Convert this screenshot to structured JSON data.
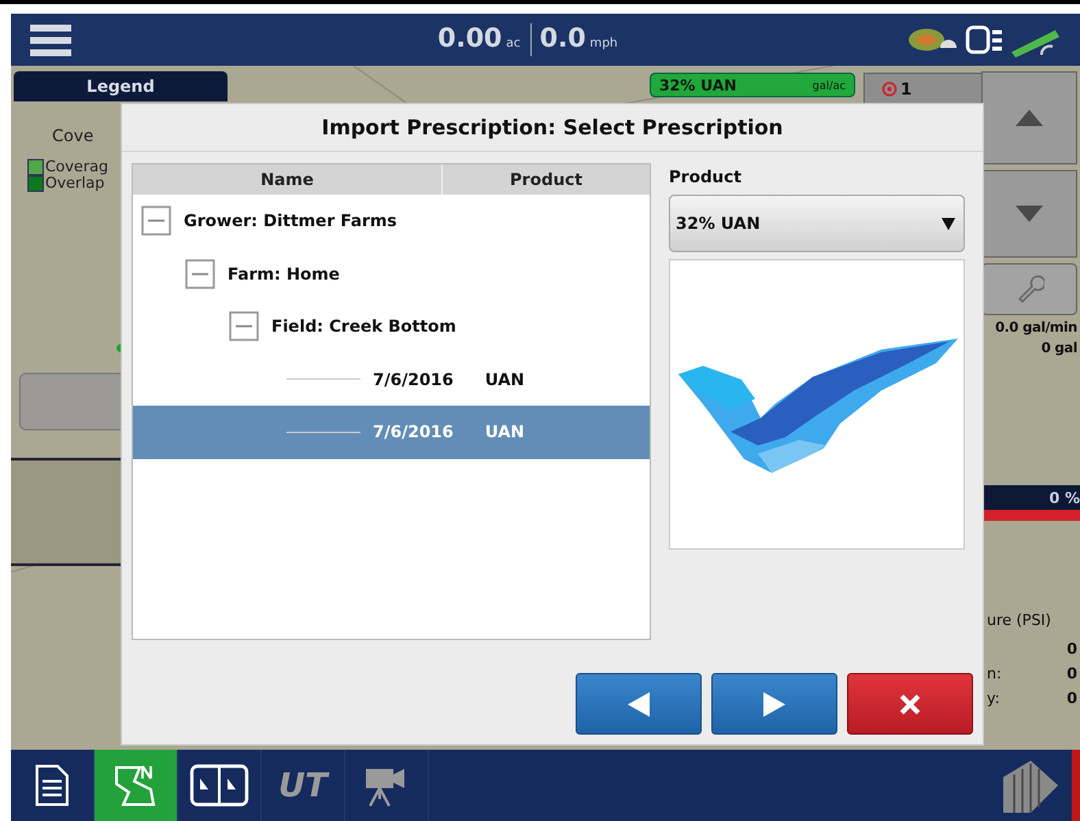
{
  "top_bar": {
    "area": "0.00",
    "area_unit": "ac",
    "speed": "0.0",
    "speed_unit": "mph"
  },
  "legend": {
    "title": "Legend",
    "heading": "Cove",
    "items": [
      {
        "label": "Coverag",
        "color": "#4fa84a"
      },
      {
        "label": "Overlap",
        "color": "#0b7a1e"
      }
    ]
  },
  "product_badge": {
    "name": "32% UAN",
    "unit": "gal/ac"
  },
  "alarm": {
    "count": "1"
  },
  "right_panel": {
    "flow": "0.0 gal/min",
    "total": "0 gal",
    "percent": "0 %",
    "pressure_title": "ure (PSI)",
    "readings": [
      {
        "value": "0"
      },
      {
        "label": "n:",
        "value": "0"
      },
      {
        "label": "y:",
        "value": "0"
      }
    ]
  },
  "dialog": {
    "title": "Import Prescription: Select Prescription",
    "columns": [
      "Name",
      "Product"
    ],
    "tree": [
      {
        "label": "Grower: Dittmer Farms",
        "expanded": true,
        "children": [
          {
            "label": "Farm: Home",
            "expanded": true,
            "children": [
              {
                "label": "Field: Creek Bottom",
                "expanded": true,
                "children": [
                  {
                    "label": "7/6/2016",
                    "product": "UAN",
                    "selected": false
                  },
                  {
                    "label": "7/6/2016",
                    "product": "UAN",
                    "selected": true
                  }
                ]
              }
            ]
          }
        ]
      }
    ],
    "product_label": "Product",
    "product_value": "32% UAN",
    "buttons": [
      {
        "kind": "back"
      },
      {
        "kind": "forward"
      },
      {
        "kind": "cancel"
      }
    ]
  },
  "bottom_bar": [
    {
      "kind": "document",
      "selected": false
    },
    {
      "kind": "field",
      "selected": true
    },
    {
      "kind": "split",
      "selected": false
    },
    {
      "kind": "ut",
      "text": "UT",
      "selected": false
    },
    {
      "kind": "camera",
      "selected": false
    }
  ]
}
